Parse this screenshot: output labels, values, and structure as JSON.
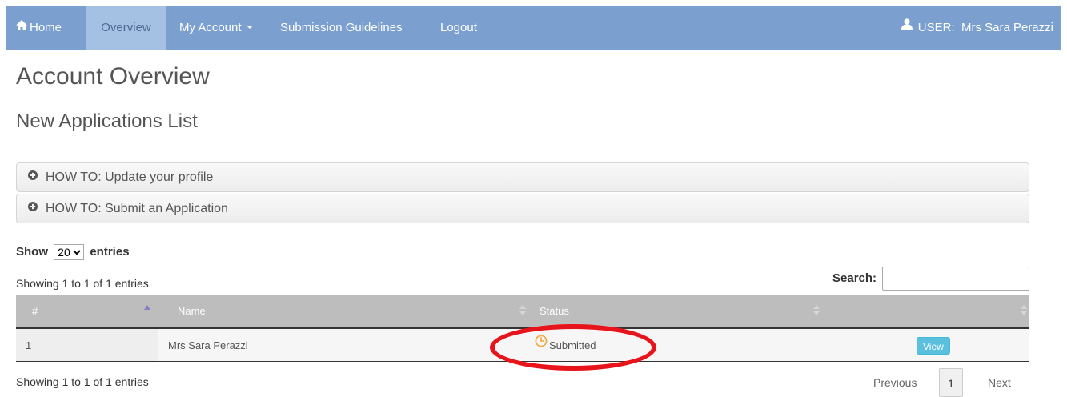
{
  "navbar": {
    "home": "Home",
    "overview": "Overview",
    "my_account": "My Account",
    "guidelines": "Submission Guidelines",
    "logout": "Logout",
    "user_label": "USER:  Mrs Sara Perazzi",
    "bg_color": "#7ba0cf"
  },
  "page": {
    "title": "Account Overview",
    "subtitle": "New Applications List"
  },
  "howto": [
    {
      "label": "HOW TO: Update your profile",
      "icon": "plus-circle-icon"
    },
    {
      "label": "HOW TO: Submit an Application",
      "icon": "plus-circle-icon"
    }
  ],
  "table_controls": {
    "show_label": "Show",
    "entries_label": "entries",
    "page_length": "20",
    "info": "Showing 1 to 1 of 1 entries",
    "search_label": "Search:",
    "search_value": ""
  },
  "table": {
    "headers": [
      "#",
      "Name",
      "Status",
      ""
    ],
    "rows": [
      {
        "num": "1",
        "name": "Mrs Sara Perazzi",
        "status": "Submitted",
        "action": "View"
      }
    ]
  },
  "pagination": {
    "previous": "Previous",
    "current_page": "1",
    "next": "Next"
  },
  "colors": {
    "status_submitted": "#f0ad4e",
    "view_button": "#5bc0de",
    "highlight": "#e8141b"
  }
}
